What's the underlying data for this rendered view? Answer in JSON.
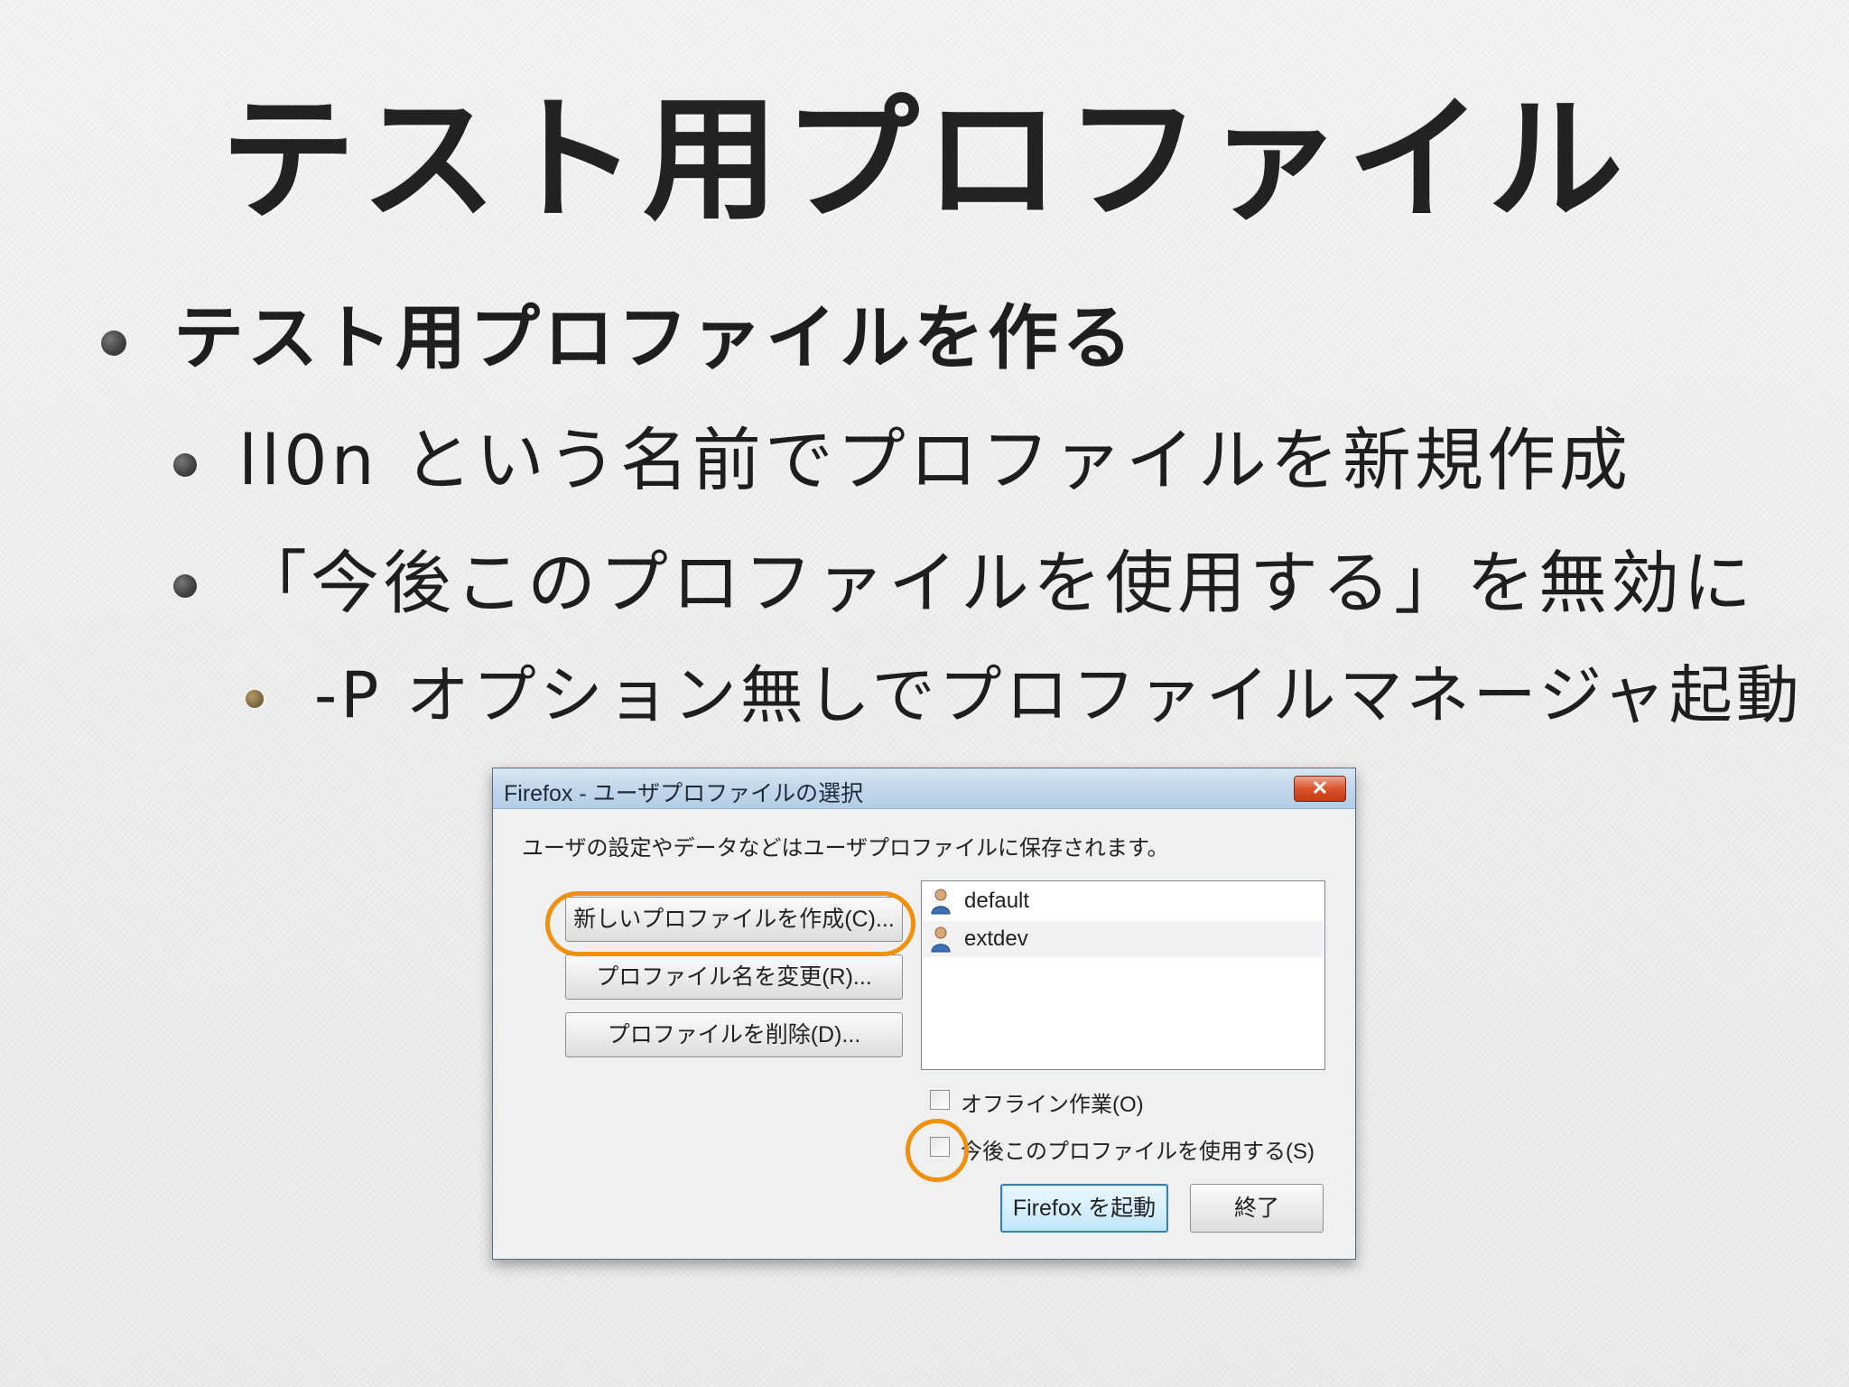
{
  "slide": {
    "title": "テスト用プロファイル",
    "bullets": [
      "テスト用プロファイルを作る",
      "ll0n という名前でプロファイルを新規作成",
      "「今後このプロファイルを使用する」を無効に",
      "-P オプション無しでプロファイルマネージャ起動"
    ]
  },
  "dialog": {
    "title": "Firefox - ユーザプロファイルの選択",
    "close_label": "✕",
    "intro": "ユーザの設定やデータなどはユーザプロファイルに保存されます。",
    "buttons": {
      "create": "新しいプロファイルを作成(C)...",
      "rename": "プロファイル名を変更(R)...",
      "delete": "プロファイルを削除(D)...",
      "start": "Firefox を起動",
      "exit": "終了"
    },
    "profiles": [
      "default",
      "extdev"
    ],
    "checkboxes": {
      "offline": "オフライン作業(O)",
      "use_profile": "今後このプロファイルを使用する(S)"
    }
  },
  "colors": {
    "highlight": "#f0900f",
    "titlebar": "#c2d7eb",
    "close_button": "#d9542c"
  },
  "icons": [
    "bullet-dot",
    "user-icon",
    "close-icon"
  ]
}
